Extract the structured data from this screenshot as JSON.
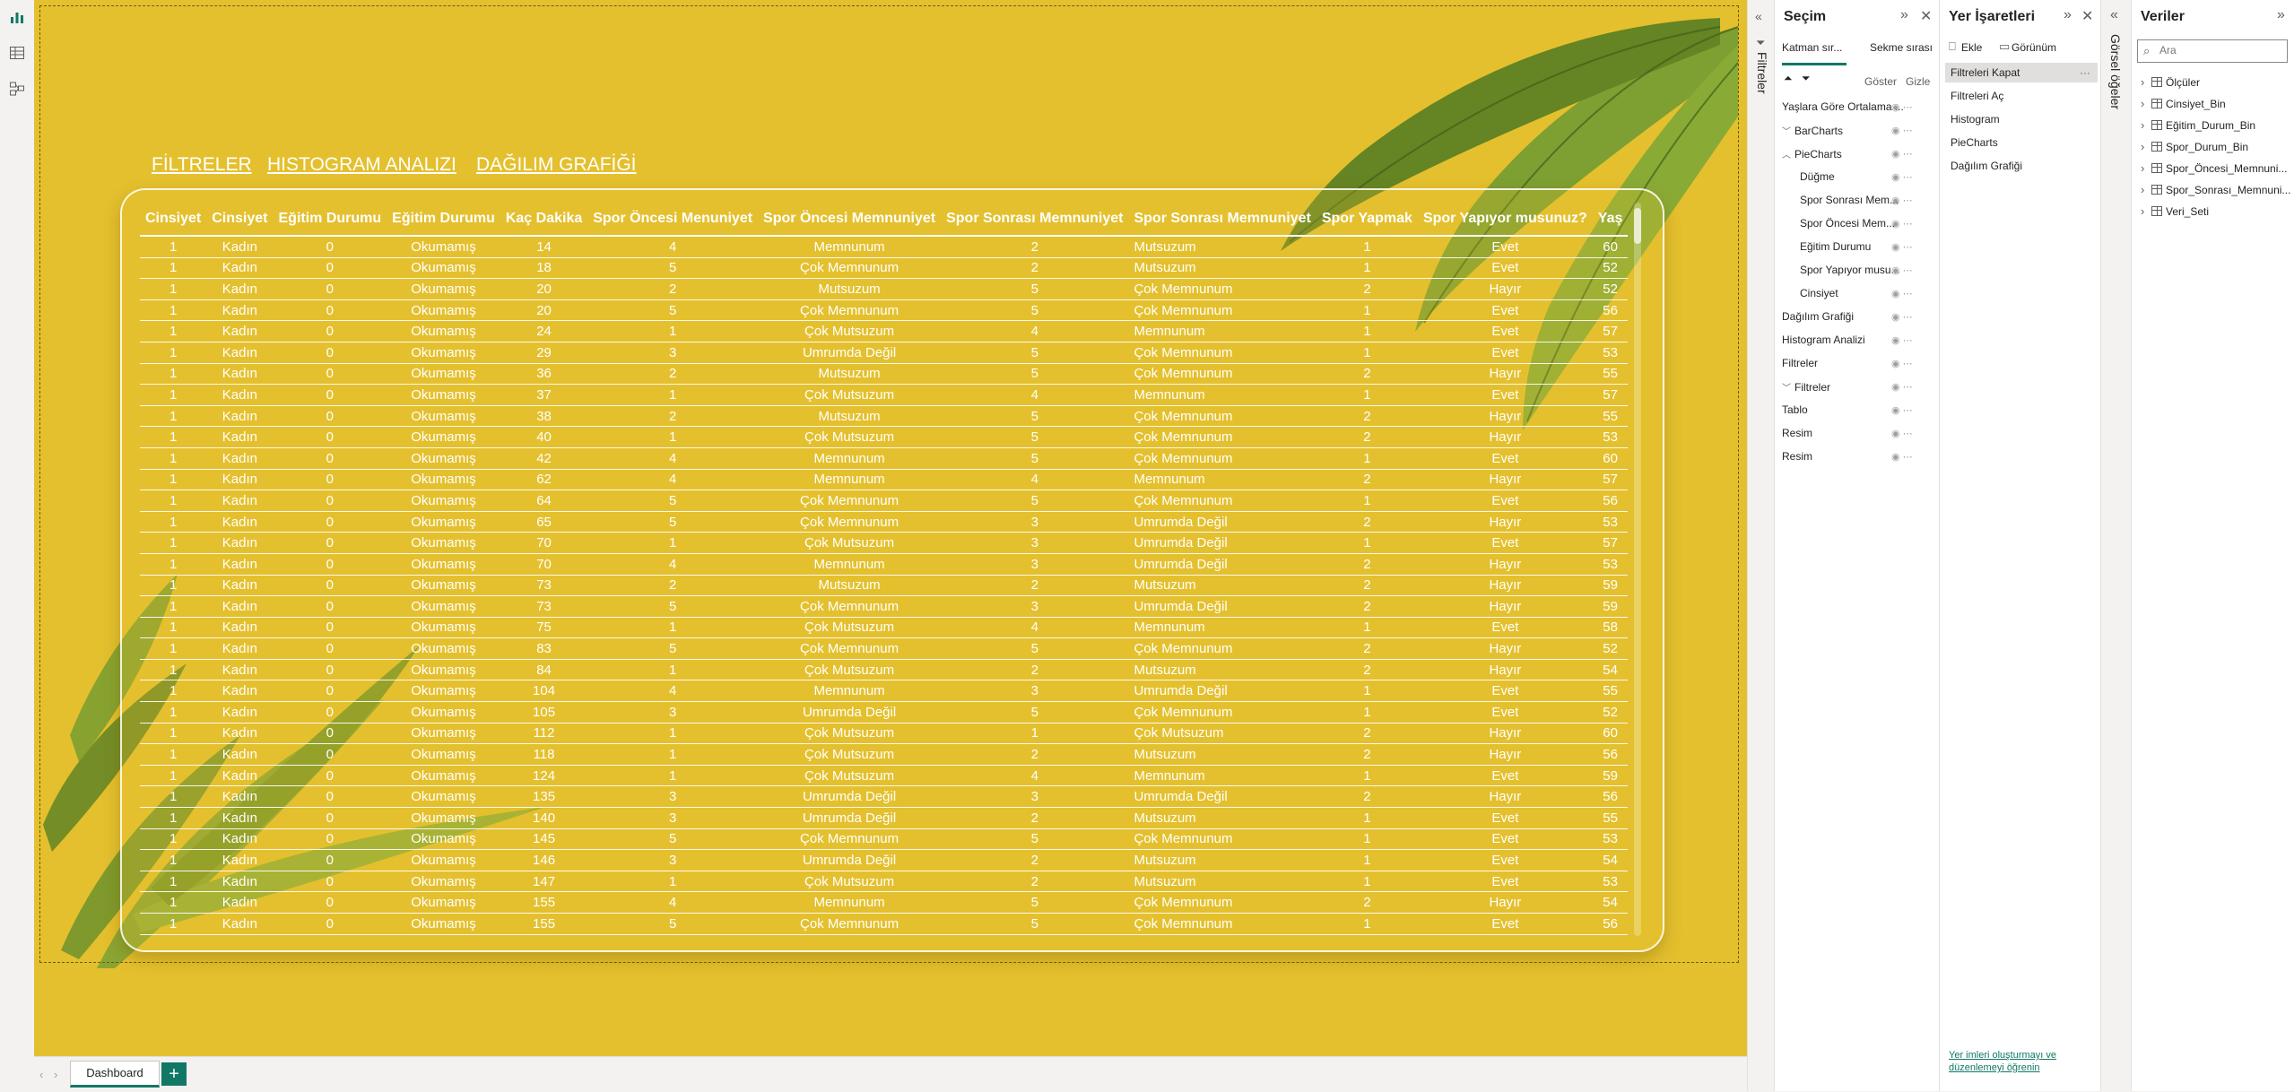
{
  "canvas": {
    "nav_links": [
      "FİLTRELER",
      "HISTOGRAM ANALIZI",
      "DAĞILIM GRAFİĞİ"
    ],
    "bg_color": "#e4c02e"
  },
  "table": {
    "headers": [
      "Cinsiyet",
      "Cinsiyet",
      "Eğitim Durumu",
      "Eğitim Durumu",
      "Kaç Dakika",
      "Spor Öncesi Menuniyet",
      "Spor Öncesi Memnuniyet",
      "Spor Sonrası Memnuniyet",
      "Spor Sonrası Memnuniyet",
      "Spor Yapmak",
      "Spor Yapıyor musunuz?",
      "Yaş"
    ],
    "rows": [
      [
        "1",
        "Kadın",
        "0",
        "Okumamış",
        "14",
        "4",
        "Memnunum",
        "2",
        "Mutsuzum",
        "1",
        "Evet",
        "60"
      ],
      [
        "1",
        "Kadın",
        "0",
        "Okumamış",
        "18",
        "5",
        "Çok Memnunum",
        "2",
        "Mutsuzum",
        "1",
        "Evet",
        "52"
      ],
      [
        "1",
        "Kadın",
        "0",
        "Okumamış",
        "20",
        "2",
        "Mutsuzum",
        "5",
        "Çok Memnunum",
        "2",
        "Hayır",
        "52"
      ],
      [
        "1",
        "Kadın",
        "0",
        "Okumamış",
        "20",
        "5",
        "Çok Memnunum",
        "5",
        "Çok Memnunum",
        "1",
        "Evet",
        "56"
      ],
      [
        "1",
        "Kadın",
        "0",
        "Okumamış",
        "24",
        "1",
        "Çok Mutsuzum",
        "4",
        "Memnunum",
        "1",
        "Evet",
        "57"
      ],
      [
        "1",
        "Kadın",
        "0",
        "Okumamış",
        "29",
        "3",
        "Umrumda Değil",
        "5",
        "Çok Memnunum",
        "1",
        "Evet",
        "53"
      ],
      [
        "1",
        "Kadın",
        "0",
        "Okumamış",
        "36",
        "2",
        "Mutsuzum",
        "5",
        "Çok Memnunum",
        "2",
        "Hayır",
        "55"
      ],
      [
        "1",
        "Kadın",
        "0",
        "Okumamış",
        "37",
        "1",
        "Çok Mutsuzum",
        "4",
        "Memnunum",
        "1",
        "Evet",
        "57"
      ],
      [
        "1",
        "Kadın",
        "0",
        "Okumamış",
        "38",
        "2",
        "Mutsuzum",
        "5",
        "Çok Memnunum",
        "2",
        "Hayır",
        "55"
      ],
      [
        "1",
        "Kadın",
        "0",
        "Okumamış",
        "40",
        "1",
        "Çok Mutsuzum",
        "5",
        "Çok Memnunum",
        "2",
        "Hayır",
        "53"
      ],
      [
        "1",
        "Kadın",
        "0",
        "Okumamış",
        "42",
        "4",
        "Memnunum",
        "5",
        "Çok Memnunum",
        "1",
        "Evet",
        "60"
      ],
      [
        "1",
        "Kadın",
        "0",
        "Okumamış",
        "62",
        "4",
        "Memnunum",
        "4",
        "Memnunum",
        "2",
        "Hayır",
        "57"
      ],
      [
        "1",
        "Kadın",
        "0",
        "Okumamış",
        "64",
        "5",
        "Çok Memnunum",
        "5",
        "Çok Memnunum",
        "1",
        "Evet",
        "56"
      ],
      [
        "1",
        "Kadın",
        "0",
        "Okumamış",
        "65",
        "5",
        "Çok Memnunum",
        "3",
        "Umrumda Değil",
        "2",
        "Hayır",
        "53"
      ],
      [
        "1",
        "Kadın",
        "0",
        "Okumamış",
        "70",
        "1",
        "Çok Mutsuzum",
        "3",
        "Umrumda Değil",
        "1",
        "Evet",
        "57"
      ],
      [
        "1",
        "Kadın",
        "0",
        "Okumamış",
        "70",
        "4",
        "Memnunum",
        "3",
        "Umrumda Değil",
        "2",
        "Hayır",
        "53"
      ],
      [
        "1",
        "Kadın",
        "0",
        "Okumamış",
        "73",
        "2",
        "Mutsuzum",
        "2",
        "Mutsuzum",
        "2",
        "Hayır",
        "59"
      ],
      [
        "1",
        "Kadın",
        "0",
        "Okumamış",
        "73",
        "5",
        "Çok Memnunum",
        "3",
        "Umrumda Değil",
        "2",
        "Hayır",
        "59"
      ],
      [
        "1",
        "Kadın",
        "0",
        "Okumamış",
        "75",
        "1",
        "Çok Mutsuzum",
        "4",
        "Memnunum",
        "1",
        "Evet",
        "58"
      ],
      [
        "1",
        "Kadın",
        "0",
        "Okumamış",
        "83",
        "5",
        "Çok Memnunum",
        "5",
        "Çok Memnunum",
        "2",
        "Hayır",
        "52"
      ],
      [
        "1",
        "Kadın",
        "0",
        "Okumamış",
        "84",
        "1",
        "Çok Mutsuzum",
        "2",
        "Mutsuzum",
        "2",
        "Hayır",
        "54"
      ],
      [
        "1",
        "Kadın",
        "0",
        "Okumamış",
        "104",
        "4",
        "Memnunum",
        "3",
        "Umrumda Değil",
        "1",
        "Evet",
        "55"
      ],
      [
        "1",
        "Kadın",
        "0",
        "Okumamış",
        "105",
        "3",
        "Umrumda Değil",
        "5",
        "Çok Memnunum",
        "1",
        "Evet",
        "52"
      ],
      [
        "1",
        "Kadın",
        "0",
        "Okumamış",
        "112",
        "1",
        "Çok Mutsuzum",
        "1",
        "Çok Mutsuzum",
        "2",
        "Hayır",
        "60"
      ],
      [
        "1",
        "Kadın",
        "0",
        "Okumamış",
        "118",
        "1",
        "Çok Mutsuzum",
        "2",
        "Mutsuzum",
        "2",
        "Hayır",
        "56"
      ],
      [
        "1",
        "Kadın",
        "0",
        "Okumamış",
        "124",
        "1",
        "Çok Mutsuzum",
        "4",
        "Memnunum",
        "1",
        "Evet",
        "59"
      ],
      [
        "1",
        "Kadın",
        "0",
        "Okumamış",
        "135",
        "3",
        "Umrumda Değil",
        "3",
        "Umrumda Değil",
        "2",
        "Hayır",
        "56"
      ],
      [
        "1",
        "Kadın",
        "0",
        "Okumamış",
        "140",
        "3",
        "Umrumda Değil",
        "2",
        "Mutsuzum",
        "1",
        "Evet",
        "55"
      ],
      [
        "1",
        "Kadın",
        "0",
        "Okumamış",
        "145",
        "5",
        "Çok Memnunum",
        "5",
        "Çok Memnunum",
        "1",
        "Evet",
        "53"
      ],
      [
        "1",
        "Kadın",
        "0",
        "Okumamış",
        "146",
        "3",
        "Umrumda Değil",
        "2",
        "Mutsuzum",
        "1",
        "Evet",
        "54"
      ],
      [
        "1",
        "Kadın",
        "0",
        "Okumamış",
        "147",
        "1",
        "Çok Mutsuzum",
        "2",
        "Mutsuzum",
        "1",
        "Evet",
        "53"
      ],
      [
        "1",
        "Kadın",
        "0",
        "Okumamış",
        "155",
        "4",
        "Memnunum",
        "5",
        "Çok Memnunum",
        "2",
        "Hayır",
        "54"
      ],
      [
        "1",
        "Kadın",
        "0",
        "Okumamış",
        "155",
        "5",
        "Çok Memnunum",
        "5",
        "Çok Memnunum",
        "1",
        "Evet",
        "56"
      ]
    ]
  },
  "tabs": {
    "page_name": "Dashboard",
    "add_label": "+"
  },
  "filters_pane": {
    "label": "Filtreler"
  },
  "selection": {
    "title": "Seçim",
    "tab_layer": "Katman sır...",
    "tab_tab": "Sekme sırası",
    "show_label": "Göster",
    "hide_label": "Gizle",
    "items": [
      {
        "label": "Yaşlara Göre Ortalama ...",
        "indent": 0,
        "caret": ""
      },
      {
        "label": "BarCharts",
        "indent": 1,
        "caret": "﹀"
      },
      {
        "label": "PieCharts",
        "indent": 1,
        "caret": "︿"
      },
      {
        "label": "Düğme",
        "indent": 2,
        "caret": ""
      },
      {
        "label": "Spor Sonrası Mem...",
        "indent": 2,
        "caret": ""
      },
      {
        "label": "Spor Öncesi Mem...",
        "indent": 2,
        "caret": ""
      },
      {
        "label": "Eğitim Durumu",
        "indent": 2,
        "caret": ""
      },
      {
        "label": "Spor Yapıyor musu...",
        "indent": 2,
        "caret": ""
      },
      {
        "label": "Cinsiyet",
        "indent": 2,
        "caret": ""
      },
      {
        "label": "Dağılım Grafiği",
        "indent": 0,
        "caret": ""
      },
      {
        "label": "Histogram Analizi",
        "indent": 0,
        "caret": ""
      },
      {
        "label": "Filtreler",
        "indent": 0,
        "caret": ""
      },
      {
        "label": "Filtreler",
        "indent": 1,
        "caret": "﹀"
      },
      {
        "label": "Tablo",
        "indent": 0,
        "caret": ""
      },
      {
        "label": "Resim",
        "indent": 0,
        "caret": ""
      },
      {
        "label": "Resim",
        "indent": 0,
        "caret": ""
      }
    ]
  },
  "bookmarks": {
    "title": "Yer İşaretleri",
    "add_label": "Ekle",
    "view_label": "Görünüm",
    "items": [
      "Filtreleri Kapat",
      "Filtreleri Aç",
      "Histogram",
      "PieCharts",
      "Dağılım Grafiği"
    ],
    "selected_index": 0,
    "more_label": "···",
    "help_link": "Yer imleri oluşturmayı ve düzenlemeyi öğrenin"
  },
  "visuals_pane": {
    "label": "Görsel öğeler"
  },
  "data_pane": {
    "title": "Veriler",
    "search_placeholder": "Ara",
    "items": [
      "Ölçüler",
      "Cinsiyet_Bin",
      "Eğitim_Durum_Bin",
      "Spor_Durum_Bin",
      "Spor_Öncesi_Memnuni...",
      "Spor_Sonrası_Memnuni...",
      "Veri_Seti"
    ]
  }
}
